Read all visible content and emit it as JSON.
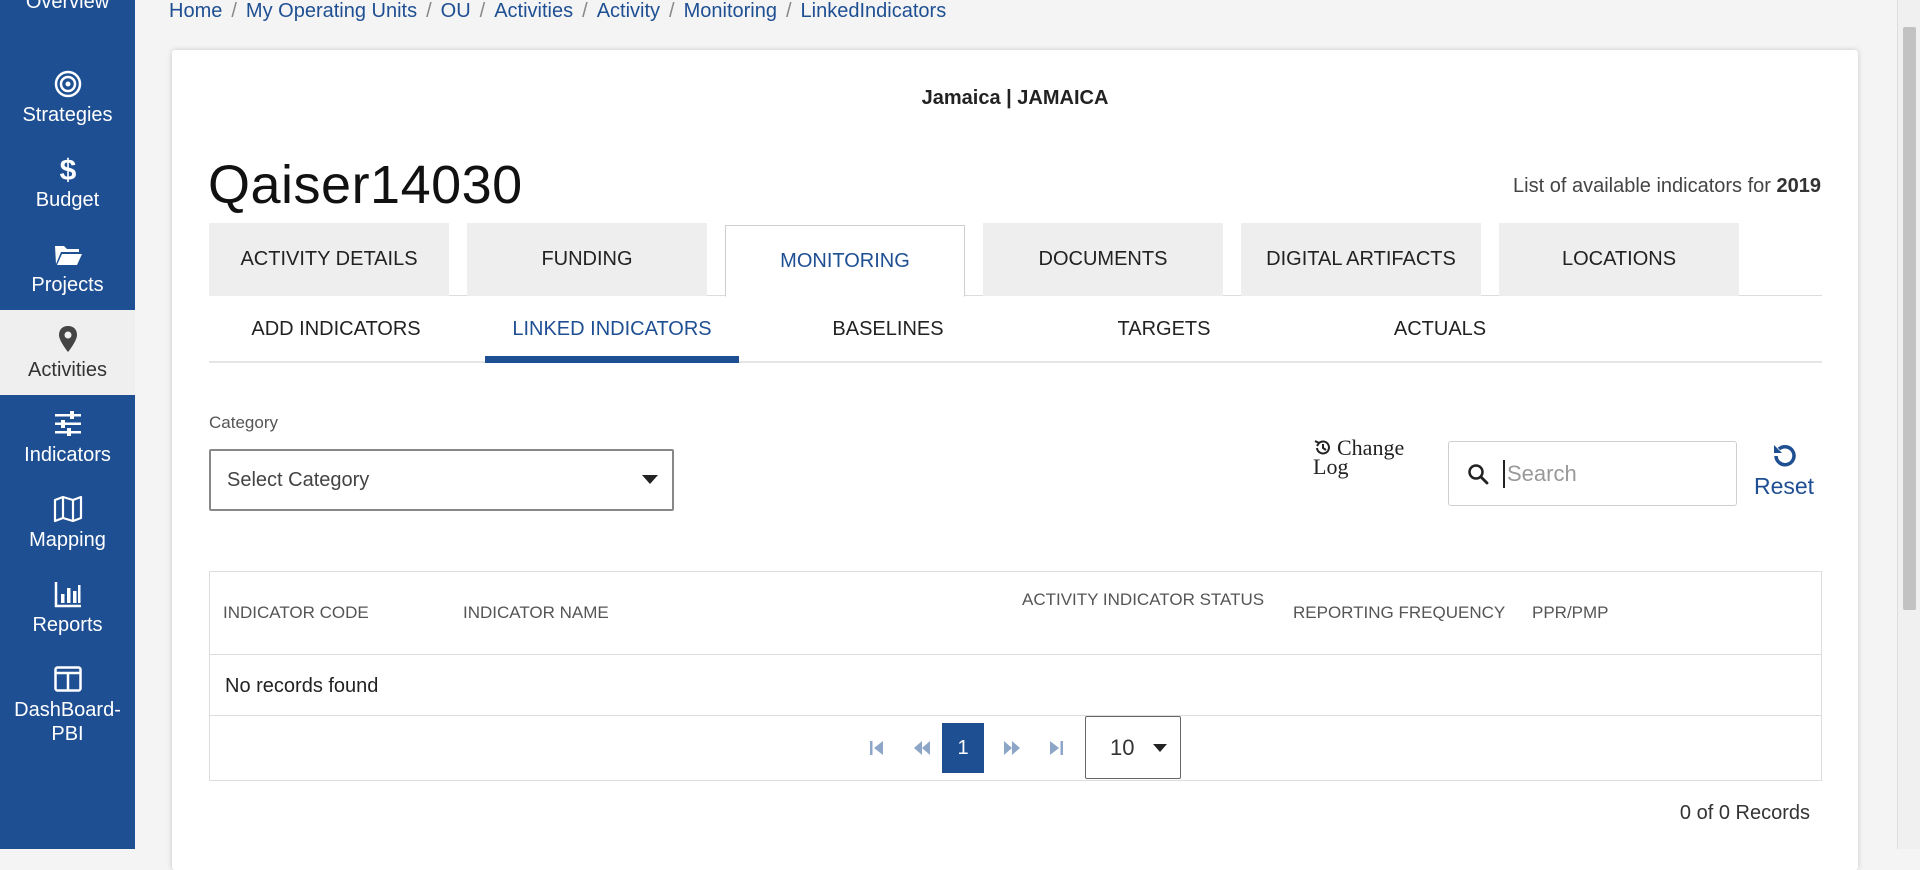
{
  "sidebar": {
    "items": [
      {
        "label": "Overview",
        "icon": "overview-icon"
      },
      {
        "label": "Strategies",
        "icon": "target-icon"
      },
      {
        "label": "Budget",
        "icon": "dollar-icon"
      },
      {
        "label": "Projects",
        "icon": "folder-icon"
      },
      {
        "label": "Activities",
        "icon": "map-pin-icon",
        "active": true
      },
      {
        "label": "Indicators",
        "icon": "sliders-icon"
      },
      {
        "label": "Mapping",
        "icon": "map-icon"
      },
      {
        "label": "Reports",
        "icon": "bar-chart-icon"
      },
      {
        "label": "DashBoard-PBI",
        "icon": "dashboard-icon"
      }
    ]
  },
  "breadcrumb": [
    "Home",
    "My Operating Units",
    "OU",
    "Activities",
    "Activity",
    "Monitoring",
    "LinkedIndicators"
  ],
  "header": {
    "ou": "Jamaica | JAMAICA",
    "activity_title": "Qaiser14030",
    "indicators_prefix": "List of available indicators for ",
    "indicators_year": "2019"
  },
  "tabs": [
    "ACTIVITY DETAILS",
    "FUNDING",
    "MONITORING",
    "DOCUMENTS",
    "DIGITAL ARTIFACTS",
    "LOCATIONS"
  ],
  "subtabs": [
    "ADD INDICATORS",
    "LINKED INDICATORS",
    "BASELINES",
    "TARGETS",
    "ACTUALS"
  ],
  "filters": {
    "category_label": "Category",
    "category_value": "Select Category",
    "change_log_line1": "Change",
    "change_log_line2": "Log",
    "search_placeholder": "Search",
    "reset_label": "Reset"
  },
  "table": {
    "columns": [
      "INDICATOR CODE",
      "INDICATOR NAME",
      "ACTIVITY INDICATOR STATUS",
      "REPORTING FREQUENCY",
      "PPR/PMP"
    ],
    "empty_message": "No records found",
    "current_page": "1",
    "page_size": "10",
    "records_summary": "0 of 0 Records"
  },
  "colors": {
    "brand": "#1f4f93",
    "sidebar_active_bg": "#efefef"
  }
}
